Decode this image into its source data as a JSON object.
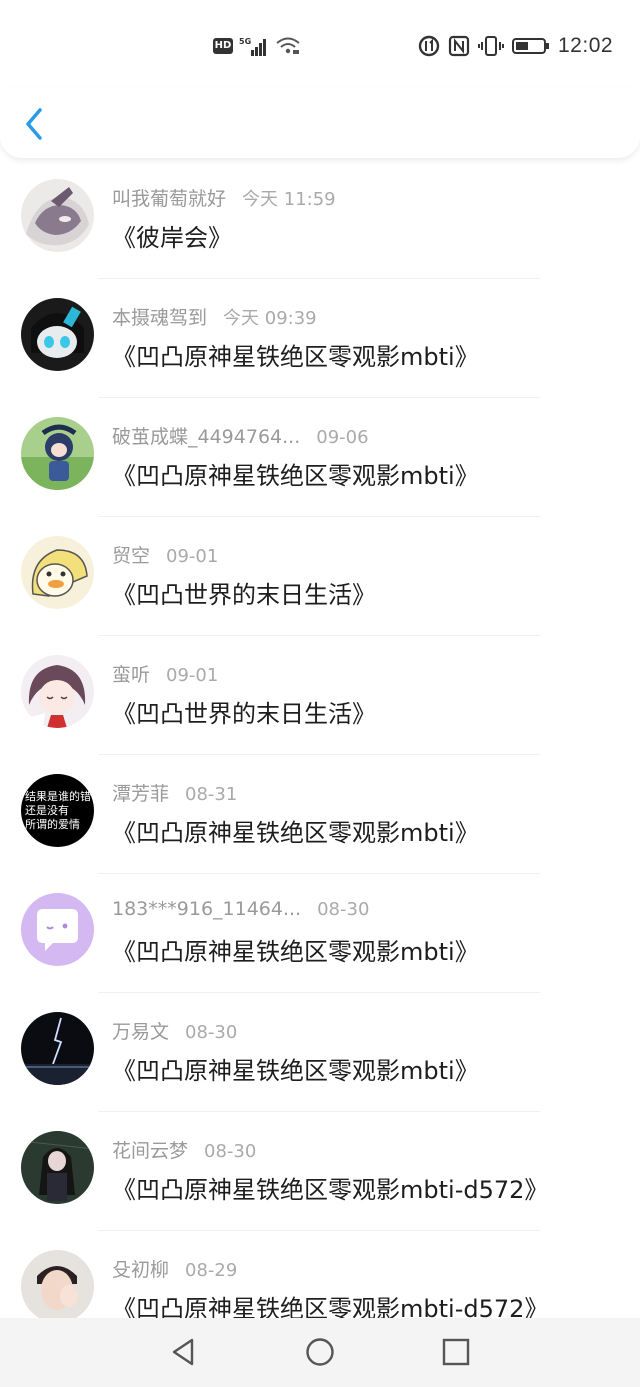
{
  "status_bar": {
    "time": "12:02",
    "hd_label": "HD",
    "network_label": "5G",
    "icons": [
      "hd-icon",
      "5g-signal-icon",
      "wifi-icon",
      "data-saver-icon",
      "nfc-icon",
      "vibrate-icon",
      "battery-icon"
    ]
  },
  "nav": {
    "back_icon": "chevron-left-icon",
    "accent": "#2b9ae8"
  },
  "items": [
    {
      "name": "叫我葡萄就好",
      "time": "今天 11:59",
      "title": "《彼岸会》"
    },
    {
      "name": "本摄魂驾到",
      "time": "今天 09:39",
      "title": "《凹凸原神星铁绝区零观影mbti》"
    },
    {
      "name": "破茧成蝶_4494764...",
      "time": "09-06",
      "title": "《凹凸原神星铁绝区零观影mbti》"
    },
    {
      "name": "贸空",
      "time": "09-01",
      "title": "《凹凸世界的末日生活》"
    },
    {
      "name": "蛮听",
      "time": "09-01",
      "title": "《凹凸世界的末日生活》"
    },
    {
      "name": "潭芳菲",
      "time": "08-31",
      "title": "《凹凸原神星铁绝区零观影mbti》",
      "avatar_text": "结果是谁的错\n还是没有\n所谓的爱情"
    },
    {
      "name": "183***916_11464...",
      "time": "08-30",
      "title": "《凹凸原神星铁绝区零观影mbti》"
    },
    {
      "name": "万易文",
      "time": "08-30",
      "title": "《凹凸原神星铁绝区零观影mbti》"
    },
    {
      "name": "花间云梦",
      "time": "08-30",
      "title": "《凹凸原神星铁绝区零观影mbti-d572》"
    },
    {
      "name": "殳初柳",
      "time": "08-29",
      "title": "《凹凸原神星铁绝区零观影mbti-d572》"
    }
  ],
  "bottom_nav": {
    "icons": [
      "back-triangle-icon",
      "home-circle-icon",
      "recents-square-icon"
    ]
  }
}
